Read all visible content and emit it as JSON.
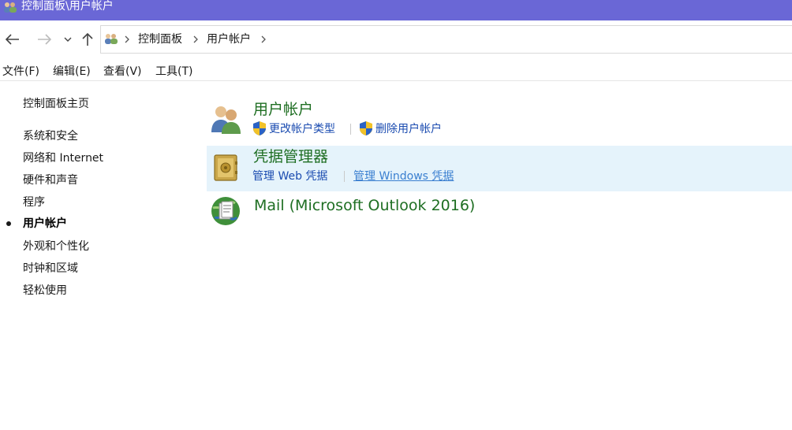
{
  "window": {
    "title": "控制面板\\用户帐户"
  },
  "address": {
    "crumbs": [
      "控制面板",
      "用户帐户"
    ]
  },
  "menu": [
    "文件(F)",
    "编辑(E)",
    "查看(V)",
    "工具(T)"
  ],
  "sidebar": {
    "home": "控制面板主页",
    "items": [
      "系统和安全",
      "网络和 Internet",
      "硬件和声音",
      "程序",
      "用户帐户",
      "外观和个性化",
      "时钟和区域",
      "轻松使用"
    ],
    "active_index": 4
  },
  "entries": [
    {
      "title": "用户帐户",
      "links": [
        "更改帐户类型",
        "删除用户帐户"
      ]
    },
    {
      "title": "凭据管理器",
      "links": [
        "管理 Web 凭据",
        "管理 Windows 凭据"
      ]
    },
    {
      "title": "Mail (Microsoft Outlook 2016)"
    }
  ],
  "icons": {
    "titlebar": "users-icon",
    "back": "back-arrow-icon",
    "forward": "forward-arrow-icon",
    "recent": "chevron-down-icon",
    "up": "up-arrow-icon",
    "entry_0": "users-icon",
    "entry_1": "vault-icon",
    "entry_2": "mail-globe-icon",
    "uac": "uac-shield-icon"
  },
  "colors": {
    "titlebar": "#6a67d6",
    "entry_title": "#1e6e22",
    "link": "#1a4bb0",
    "highlight": "#e5f3fb"
  }
}
